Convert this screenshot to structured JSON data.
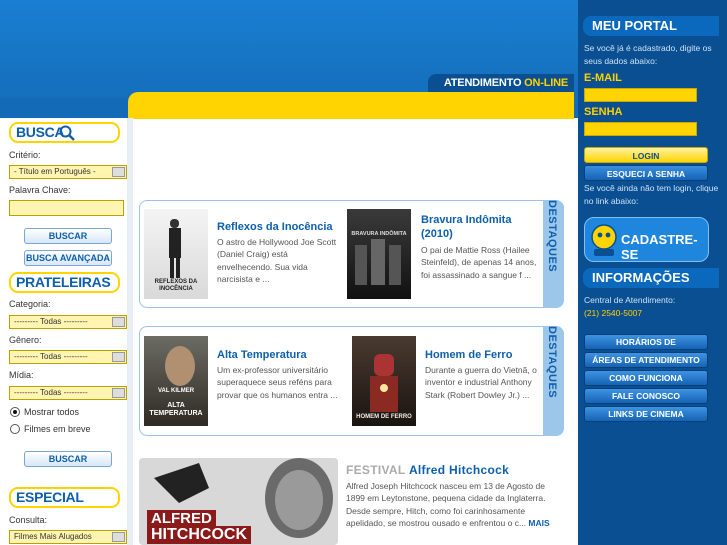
{
  "header": {
    "atendimento": "ATENDIMENTO",
    "online": "ON-LINE"
  },
  "left": {
    "busca": {
      "title": "BUSCA",
      "criterio_label": "Critério:",
      "criterio_value": "- Título em Português -",
      "palavra_label": "Palavra Chave:",
      "buscar": "BUSCAR",
      "busca_avancada": "BUSCA AVANÇADA"
    },
    "prateleiras": {
      "title": "PRATELEIRAS",
      "categoria_label": "Categoria:",
      "categoria_value": "--------- Todas ---------",
      "genero_label": "Gênero:",
      "genero_value": "--------- Todas ---------",
      "midia_label": "Mídia:",
      "midia_value": "--------- Todas ---------",
      "opt_todos": "Mostrar todos",
      "opt_breve": "Filmes em breve",
      "buscar": "BUSCAR"
    },
    "especial": {
      "title": "ESPECIAL",
      "consulta_label": "Consulta:",
      "consulta_value": "Filmes Mais Alugados"
    }
  },
  "destaques_label": "DESTAQUES",
  "movies": [
    {
      "title": "Reflexos da Inocência",
      "desc": "O astro de Hollywood Joe Scott (Daniel Craig) está envelhecendo. Sua vida narcisista e ..."
    },
    {
      "title": "Bravura Indômita (2010)",
      "desc": "O pai de Mattie Ross (Hailee Steinfeld), de apenas 14 anos, foi assassinado a sangue f ..."
    },
    {
      "title": "Alta Temperatura",
      "desc": "Um ex-professor universitário superaquece seus reféns para provar que os humanos entra ..."
    },
    {
      "title": "Homem de Ferro",
      "desc": "Durante a guerra do Vietnã, o inventor e industrial Anthony Stark (Robert Dowley Jr.) ..."
    }
  ],
  "posters": {
    "p1": "REFLEXOS DA INOCÊNCIA",
    "p2": "BRAVURA INDÔMITA",
    "p3": "VAL KILMER",
    "p3b": "ALTA TEMPERATURA",
    "p4": "HOMEM DE FERRO"
  },
  "festival": {
    "prefix": "FESTIVAL",
    "name": "Alfred Hitchcock",
    "text": "Alfred Joseph Hitchcock nasceu em 13 de Agosto de 1899 em Leytonstone, pequena cidade da Inglaterra. Desde sempre, Hitch, como foi carinhosamente apelidado, se mostrou ousado e enfrentou o c...",
    "more": "MAIS",
    "banner_line1": "ALFRED",
    "banner_line2": "HITCHCOCK"
  },
  "right": {
    "portal_title": "MEU PORTAL",
    "intro": "Se você já é cadastrado, digite os seus dados abaixo:",
    "email_label": "E-MAIL",
    "senha_label": "SENHA",
    "login": "LOGIN",
    "esqueci": "ESQUECI A SENHA",
    "nao_tem": "Se você ainda não tem login, clique no link abaixo:",
    "cadastre": "CADASTRE-SE",
    "info_title": "INFORMAÇÕES",
    "central_label": "Central de Atendimento:",
    "phone": "(21) 2540-5007",
    "nav": [
      "HORÁRIOS DE ATENDIMENTO",
      "ÁREAS DE ATENDIMENTO",
      "COMO FUNCIONA",
      "FALE CONOSCO",
      "LINKS DE CINEMA"
    ]
  },
  "colors": {
    "brand_blue": "#0d5fae",
    "yellow": "#ffd400",
    "dark_blue": "#0a4f91"
  }
}
